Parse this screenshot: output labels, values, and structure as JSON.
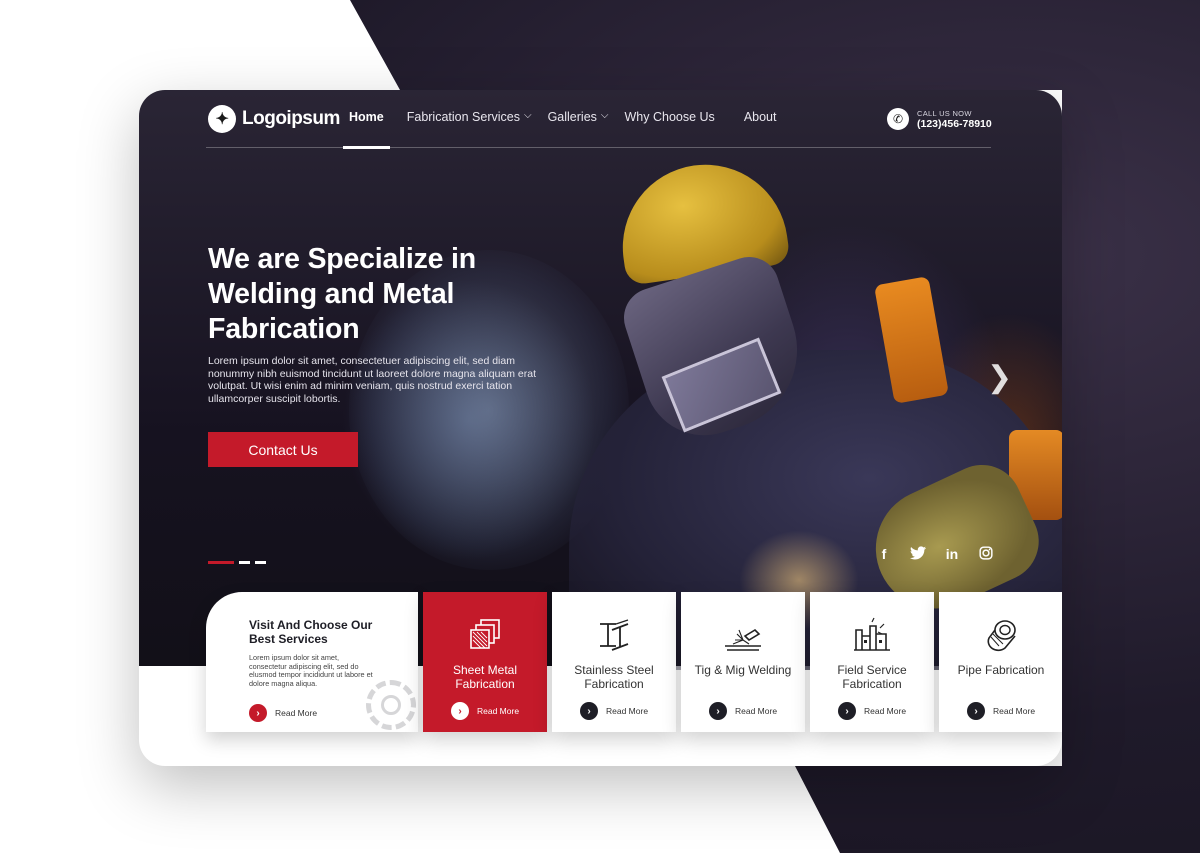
{
  "brand": {
    "name": "Logoipsum",
    "accent": "#c41a2a",
    "dark": "#1e1e26"
  },
  "nav": {
    "items": [
      {
        "label": "Home",
        "active": true,
        "dropdown": false
      },
      {
        "label": "Fabrication Services",
        "active": false,
        "dropdown": true
      },
      {
        "label": "Galleries",
        "active": false,
        "dropdown": true
      },
      {
        "label": "Why Choose Us",
        "active": false,
        "dropdown": false
      },
      {
        "label": "About",
        "active": false,
        "dropdown": false
      }
    ],
    "call_label": "CALL US NOW",
    "call_number": "(123)456-78910"
  },
  "hero": {
    "title": "We are Specialize in Welding and Metal Fabrication",
    "text": "Lorem ipsum dolor sit amet, consectetuer adipiscing elit, sed diam nonummy nibh euismod tincidunt ut laoreet dolore magna aliquam erat volutpat. Ut wisi enim ad minim veniam, quis nostrud exerci tation ullamcorper suscipit lobortis.",
    "cta": "Contact Us",
    "slide_active": 1,
    "slide_count": 3,
    "next_icon": "chevron-right-icon"
  },
  "social": [
    "facebook-icon",
    "twitter-icon",
    "linkedin-icon",
    "instagram-icon"
  ],
  "services": {
    "intro_title": "Visit And Choose Our Best Services",
    "intro_text": "Lorem ipsum dolor sit amet, consectetur adipiscing elit, sed do elusmod tempor incididunt ut labore et dolore magna aliqua.",
    "read_more": "Read More",
    "items": [
      {
        "name": "Sheet Metal Fabrication",
        "icon": "sheet-metal-icon",
        "active": true
      },
      {
        "name": "Stainless Steel Fabrication",
        "icon": "steel-beam-icon",
        "active": false
      },
      {
        "name": "Tig & Mig Welding",
        "icon": "welding-icon",
        "active": false
      },
      {
        "name": "Field Service Fabrication",
        "icon": "factory-icon",
        "active": false
      },
      {
        "name": "Pipe Fabrication",
        "icon": "pipe-icon",
        "active": false
      }
    ]
  }
}
